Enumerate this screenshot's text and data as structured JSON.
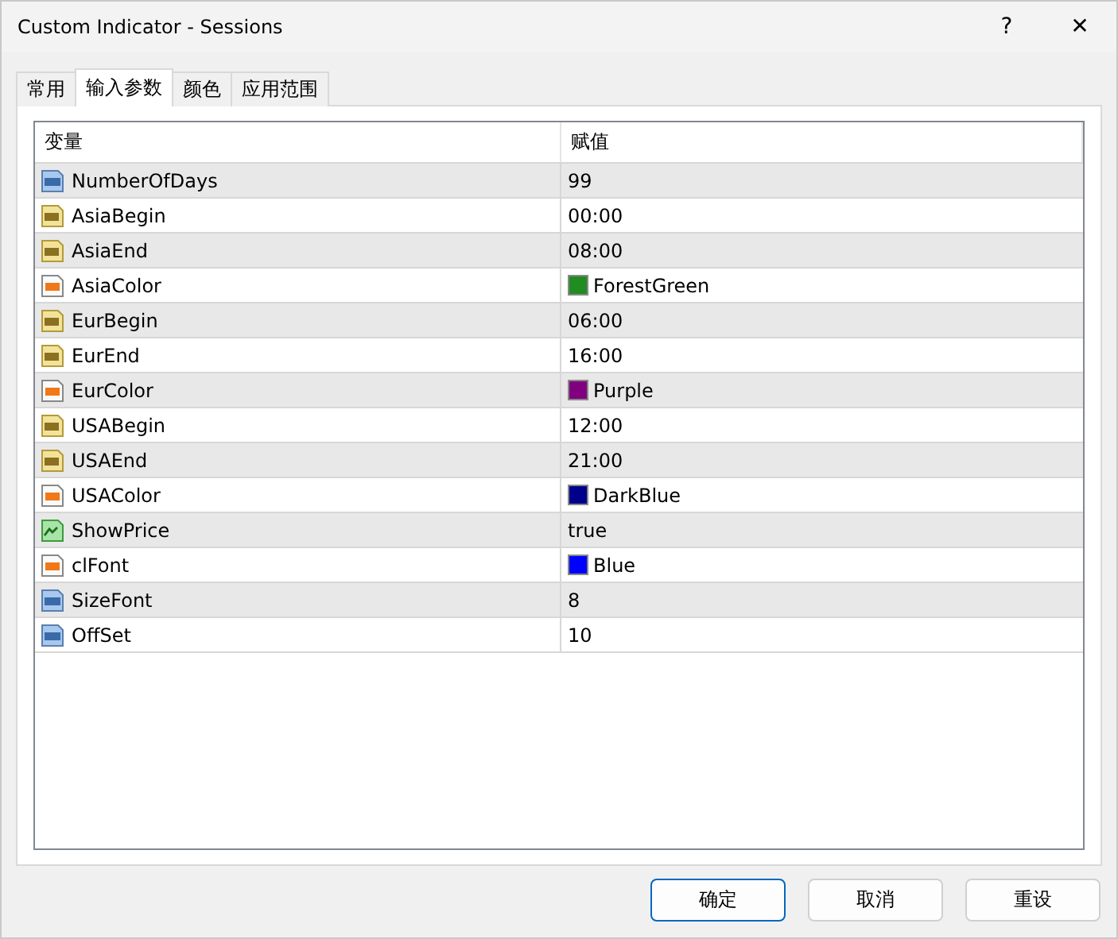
{
  "window": {
    "title": "Custom Indicator - Sessions",
    "help": "?",
    "close": "✕"
  },
  "tabs": [
    {
      "label": "常用",
      "selected": false
    },
    {
      "label": "输入参数",
      "selected": true
    },
    {
      "label": "颜色",
      "selected": false
    },
    {
      "label": "应用范围",
      "selected": false
    }
  ],
  "table": {
    "columns": [
      "变量",
      "赋值"
    ],
    "rows": [
      {
        "kind": "int",
        "name": "NumberOfDays",
        "value": "99"
      },
      {
        "kind": "string",
        "name": "AsiaBegin",
        "value": "00:00"
      },
      {
        "kind": "string",
        "name": "AsiaEnd",
        "value": "08:00"
      },
      {
        "kind": "color",
        "name": "AsiaColor",
        "value": "ForestGreen",
        "color": "#228b22"
      },
      {
        "kind": "string",
        "name": "EurBegin",
        "value": "06:00"
      },
      {
        "kind": "string",
        "name": "EurEnd",
        "value": "16:00"
      },
      {
        "kind": "color",
        "name": "EurColor",
        "value": "Purple",
        "color": "#800080"
      },
      {
        "kind": "string",
        "name": "USABegin",
        "value": "12:00"
      },
      {
        "kind": "string",
        "name": "USAEnd",
        "value": "21:00"
      },
      {
        "kind": "color",
        "name": "USAColor",
        "value": "DarkBlue",
        "color": "#00008b"
      },
      {
        "kind": "bool",
        "name": "ShowPrice",
        "value": "true"
      },
      {
        "kind": "color",
        "name": "clFont",
        "value": "Blue",
        "color": "#0000ff"
      },
      {
        "kind": "int",
        "name": "SizeFont",
        "value": "8"
      },
      {
        "kind": "int",
        "name": "OffSet",
        "value": "10"
      }
    ]
  },
  "buttons": [
    {
      "label": "确定",
      "default": true
    },
    {
      "label": "取消",
      "default": false
    },
    {
      "label": "重设",
      "default": false
    }
  ]
}
